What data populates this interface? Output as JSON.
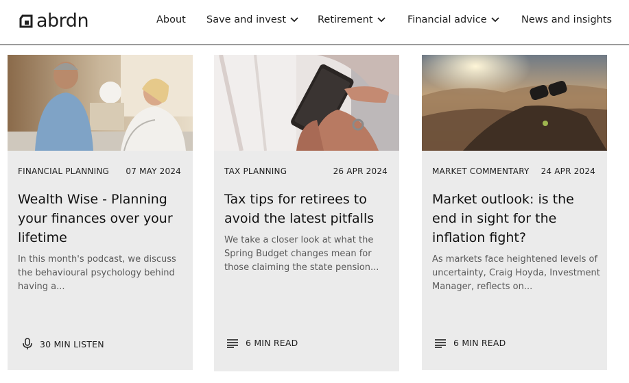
{
  "header": {
    "logo": "abrdn",
    "nav": [
      {
        "label": "About"
      },
      {
        "label": "Save and invest"
      },
      {
        "label": "Retirement"
      },
      {
        "label": "Financial advice"
      },
      {
        "label": "News and insights"
      }
    ]
  },
  "cards": [
    {
      "category": "FINANCIAL PLANNING",
      "date": "07 MAY 2024",
      "title": "Wealth Wise - Planning your finances over your lifetime",
      "excerpt": "In this month's podcast, we discuss the behavioural psychology behind having a...",
      "duration": "30 MIN LISTEN",
      "icon": "microphone-icon"
    },
    {
      "category": "TAX PLANNING",
      "date": "26 APR 2024",
      "title": "Tax tips for retirees to avoid the latest pitfalls",
      "excerpt": "We take a closer look at what the Spring Budget changes mean for those claiming the state pension...",
      "duration": "6 MIN READ",
      "icon": "article-lines-icon"
    },
    {
      "category": "MARKET COMMENTARY",
      "date": "24 APR 2024",
      "title": "Market outlook: is the end in sight for the inflation fight?",
      "excerpt": "As markets face heightened levels of uncertainty, Craig Hoyda, Investment Manager, reflects on...",
      "duration": "6 MIN READ",
      "icon": "article-lines-icon"
    }
  ],
  "colors": {
    "text": "#1e1e1e",
    "card_bg": "#ebebeb",
    "excerpt": "#5a5a5a"
  }
}
